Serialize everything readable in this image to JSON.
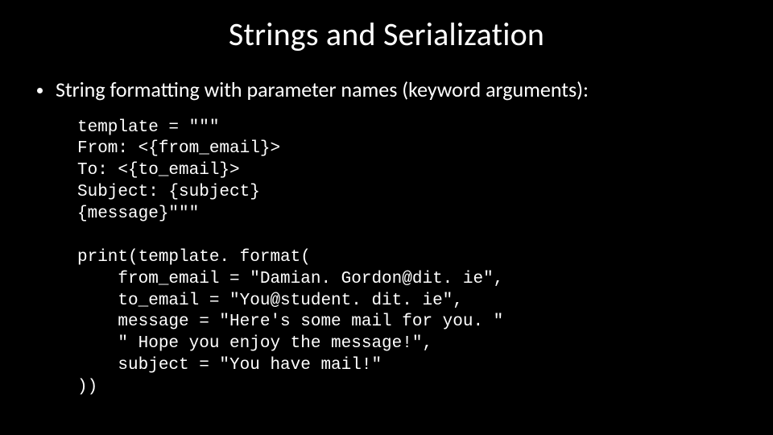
{
  "title": "Strings and Serialization",
  "bullet": "String formatting with parameter names (keyword arguments):",
  "code": "template = \"\"\"\nFrom: <{from_email}>\nTo: <{to_email}>\nSubject: {subject}\n{message}\"\"\"\n\nprint(template. format(\n    from_email = \"Damian. Gordon@dit. ie\",\n    to_email = \"You@student. dit. ie\",\n    message = \"Here's some mail for you. \"\n    \" Hope you enjoy the message!\",\n    subject = \"You have mail!\"\n))"
}
